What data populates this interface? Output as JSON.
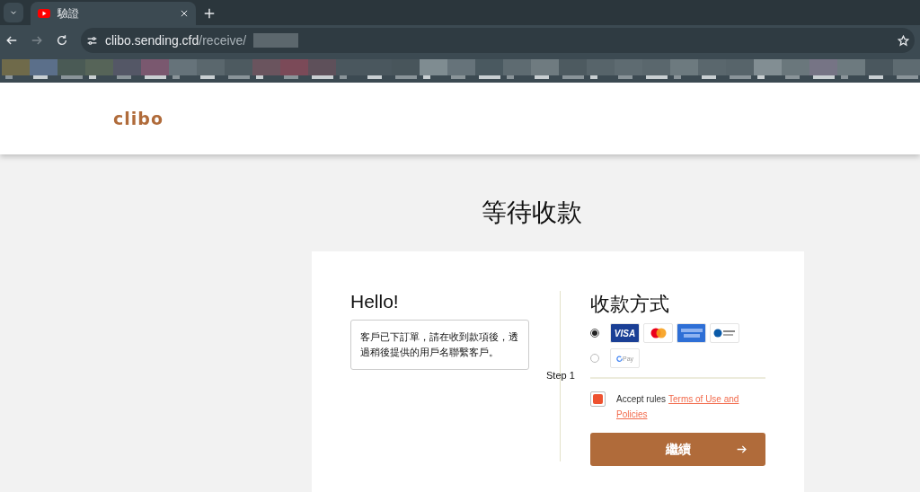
{
  "browser": {
    "tab": {
      "title": "驗證",
      "selected": true
    },
    "url": {
      "host": "clibo.sending.cfd",
      "path": "/receive/"
    }
  },
  "header": {
    "logo": "clibo"
  },
  "page_title": "等待收款",
  "greeting": {
    "title": "Hello!",
    "message": "客戶已下訂單，請在收到款項後，透過稍後提供的用戶名聯繫客戶。"
  },
  "step_label": "Step 1",
  "payment": {
    "title": "收款方式",
    "options": [
      {
        "selected": true,
        "cards": [
          {
            "kind": "visa",
            "label": "VISA"
          },
          {
            "kind": "mastercard"
          },
          {
            "kind": "amex"
          },
          {
            "kind": "diners"
          }
        ]
      },
      {
        "selected": false,
        "cards": [
          {
            "kind": "gpay",
            "label": "Pay"
          }
        ]
      }
    ]
  },
  "accept": {
    "checked": true,
    "text": "Accept rules",
    "link": [
      "Terms of Use and",
      "Policies"
    ]
  },
  "continue_button": "繼續"
}
